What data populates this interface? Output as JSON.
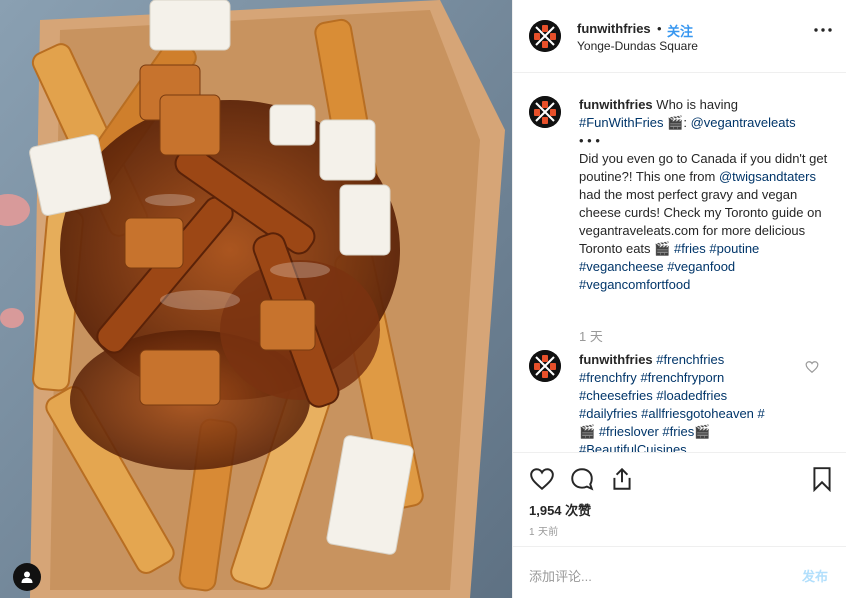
{
  "post": {
    "photo_icon": "poutine-photo",
    "user_tag_icon": "user-tag-icon"
  },
  "header": {
    "username": "funwithfries",
    "separator": "•",
    "follow_label": "关注",
    "location": "Yonge-Dundas Square",
    "more_icon": "more-options-icon"
  },
  "caption": {
    "username": "funwithfries",
    "intro": "Who is having",
    "hashtag": "#FunWithFries",
    "emoji": "🎬:",
    "mention": "@vegantraveleats",
    "dots": "• • •",
    "body_1": "Did you even go to Canada if you didn't get poutine?! This one from",
    "mention2": "@twigsandtaters",
    "body_2": "had the most perfect gravy and vegan cheese curds! Check my Toronto guide on vegantraveleats.com for more delicious Toronto eats",
    "emoji2": "🎬",
    "tags": [
      "#fries",
      "#poutine",
      "#vegancheese",
      "#veganfood",
      "#vegancomfortfood"
    ],
    "time": "1 天"
  },
  "comment": {
    "username": "funwithfries",
    "tags_line1": [
      "#frenchfries"
    ],
    "tags_line2": [
      "#frenchfry",
      "#frenchfryporn"
    ],
    "tags_line3": [
      "#cheesefries",
      "#loadedfries"
    ],
    "tags_line4": [
      "#dailyfries",
      "#allfriesgotoheaven",
      "#"
    ],
    "line5_emoji": "🎬",
    "tags_line5": [
      "#frieslover",
      "#fries"
    ],
    "line5_emoji_end": "🎬",
    "tags_line6": "#BeautifulCuisines"
  },
  "actions": {
    "likes": "1,954 次赞",
    "time_ago": "1 天前"
  },
  "composer": {
    "placeholder": "添加评论...",
    "post_label": "发布"
  },
  "colors": {
    "link": "#003569",
    "follow": "#3897f0",
    "muted": "#999999",
    "post_disabled": "#b2dffc"
  }
}
